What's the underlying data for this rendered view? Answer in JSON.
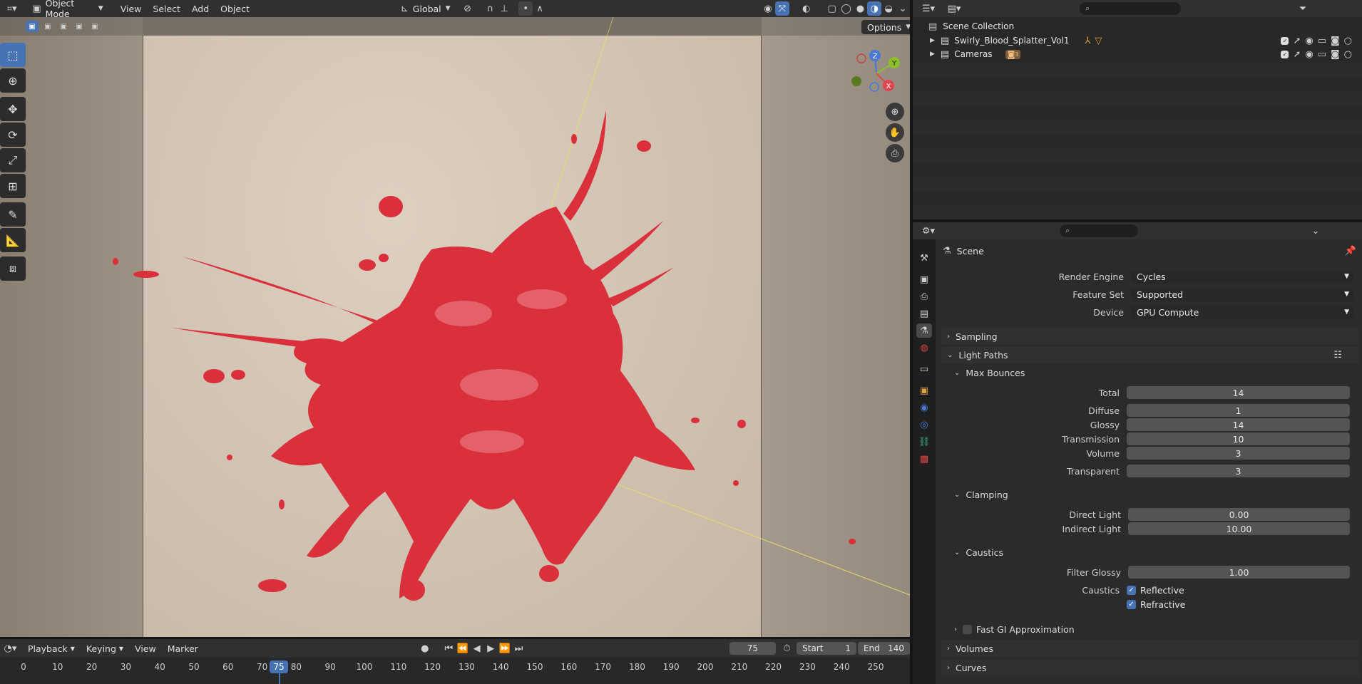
{
  "viewport_header": {
    "mode": "Object Mode",
    "menus": [
      "View",
      "Select",
      "Add",
      "Object"
    ],
    "transform_orientation": "Global",
    "options_label": "Options"
  },
  "outliner": {
    "root": "Scene Collection",
    "items": [
      {
        "label": "Swirly_Blood_Splatter_Vol1"
      },
      {
        "label": "Cameras",
        "badge": "3"
      }
    ]
  },
  "properties": {
    "context": "Scene",
    "render_engine_label": "Render Engine",
    "render_engine": "Cycles",
    "feature_set_label": "Feature Set",
    "feature_set": "Supported",
    "device_label": "Device",
    "device": "GPU Compute",
    "sampling": "Sampling",
    "light_paths": "Light Paths",
    "max_bounces": "Max Bounces",
    "bounces": [
      {
        "label": "Total",
        "value": "14"
      },
      {
        "label": "Diffuse",
        "value": "1"
      },
      {
        "label": "Glossy",
        "value": "14"
      },
      {
        "label": "Transmission",
        "value": "10"
      },
      {
        "label": "Volume",
        "value": "3"
      },
      {
        "label": "Transparent",
        "value": "3"
      }
    ],
    "clamping": "Clamping",
    "clamp": [
      {
        "label": "Direct Light",
        "value": "0.00"
      },
      {
        "label": "Indirect Light",
        "value": "10.00"
      }
    ],
    "caustics": "Caustics",
    "filter_glossy_label": "Filter Glossy",
    "filter_glossy": "1.00",
    "caustics_label": "Caustics",
    "reflective": "Reflective",
    "refractive": "Refractive",
    "fast_gi": "Fast GI Approximation",
    "volumes": "Volumes",
    "curves": "Curves"
  },
  "timeline": {
    "menus": [
      "Playback",
      "Keying",
      "View",
      "Marker"
    ],
    "current_frame": "75",
    "start_label": "Start",
    "start": "1",
    "end_label": "End",
    "end": "140",
    "ticks": [
      "0",
      "10",
      "20",
      "30",
      "40",
      "50",
      "60",
      "70",
      "80",
      "90",
      "100",
      "110",
      "120",
      "130",
      "140",
      "150",
      "160",
      "170",
      "180",
      "190",
      "200",
      "210",
      "220",
      "230",
      "240",
      "250"
    ],
    "playhead": "75"
  },
  "colors": {
    "accent": "#4772b3",
    "blood": "#d9303b",
    "backdrop": "#d8c9b8"
  }
}
